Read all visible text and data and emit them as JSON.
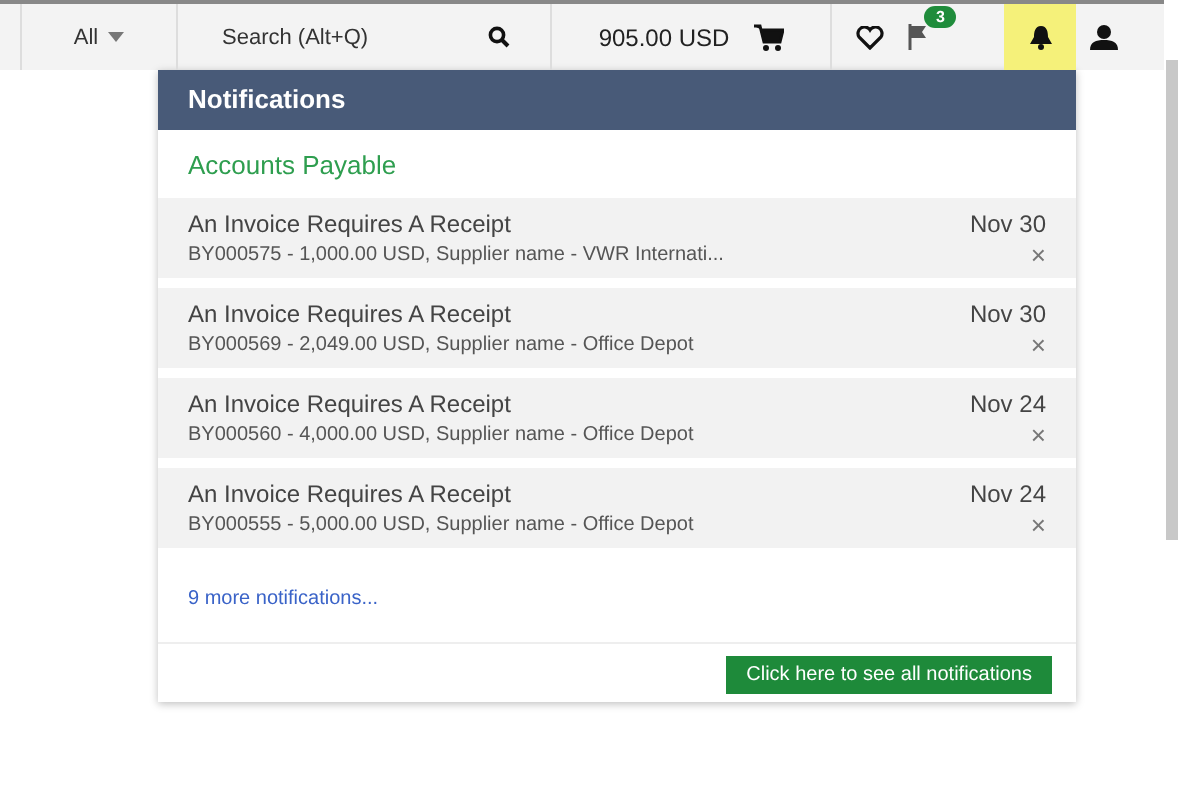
{
  "toolbar": {
    "scope": "All",
    "search": {
      "placeholder": "Search (Alt+Q)"
    },
    "cart_total": "905.00 USD",
    "flag_badge": "3",
    "bell": {
      "selected": true
    }
  },
  "notifications": {
    "title": "Notifications",
    "section": "Accounts Payable",
    "items": [
      {
        "title": "An Invoice Requires A Receipt",
        "detail": "BY000575 - 1,000.00 USD, Supplier name - VWR Internati...",
        "date": "Nov 30",
        "close": "×"
      },
      {
        "title": "An Invoice Requires A Receipt",
        "detail": "BY000569 - 2,049.00 USD, Supplier name - Office Depot",
        "date": "Nov 30",
        "close": "×"
      },
      {
        "title": "An Invoice Requires A Receipt",
        "detail": "BY000560 - 4,000.00 USD, Supplier name - Office Depot",
        "date": "Nov 24",
        "close": "×"
      },
      {
        "title": "An Invoice Requires A Receipt",
        "detail": "BY000555 - 5,000.00 USD, Supplier name - Office Depot",
        "date": "Nov 24",
        "close": "×"
      }
    ],
    "more_link": "9 more notifications...",
    "see_all_button": "Click here to see all notifications"
  }
}
